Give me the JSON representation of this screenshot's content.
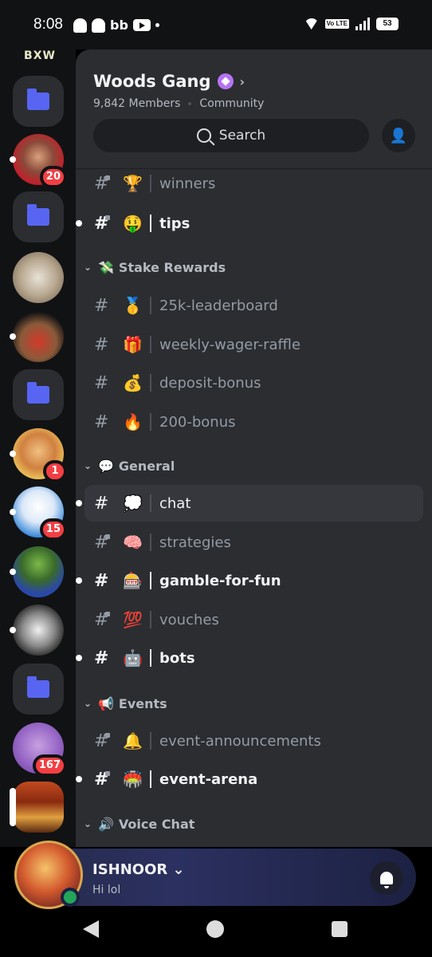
{
  "status_bar": {
    "time": "8:08",
    "left_icons": [
      "snapchat-icon",
      "snapchat-icon",
      "bb-icon",
      "youtube-icon",
      "dot-icon"
    ],
    "bb_label": "bb",
    "volte_label": "Vo LTE",
    "battery": "53"
  },
  "rail": {
    "logo_text": "BXW",
    "items": [
      {
        "type": "folder"
      },
      {
        "type": "avatar",
        "badge": "20"
      },
      {
        "type": "folder"
      },
      {
        "type": "avatar",
        "badge": ""
      },
      {
        "type": "avatar",
        "badge": ""
      },
      {
        "type": "folder"
      },
      {
        "type": "avatar",
        "badge": "1"
      },
      {
        "type": "avatar",
        "badge": "15"
      },
      {
        "type": "avatar",
        "badge": ""
      },
      {
        "type": "avatar",
        "badge": ""
      },
      {
        "type": "folder"
      },
      {
        "type": "avatar",
        "badge": "167"
      },
      {
        "type": "avatar",
        "badge": ""
      }
    ]
  },
  "server": {
    "name": "Woods Gang",
    "members": "9,842 Members",
    "type": "Community",
    "search_label": "Search"
  },
  "channels": {
    "winners": {
      "emoji": "🏆",
      "name": "winners"
    },
    "tips": {
      "emoji": "🤑",
      "name": "tips"
    },
    "cat_stake": {
      "emoji": "💸",
      "name": "Stake Rewards"
    },
    "leaderboard": {
      "emoji": "🥇",
      "name": "25k-leaderboard"
    },
    "raffle": {
      "emoji": "🎁",
      "name": "weekly-wager-raffle"
    },
    "deposit": {
      "emoji": "💰",
      "name": "deposit-bonus"
    },
    "bonus200": {
      "emoji": "🔥",
      "name": "200-bonus"
    },
    "cat_general": {
      "emoji": "💬",
      "name": "General"
    },
    "chat": {
      "emoji": "💭",
      "name": "chat"
    },
    "strategies": {
      "emoji": "🧠",
      "name": "strategies"
    },
    "gamble": {
      "emoji": "🎰",
      "name": "gamble-for-fun"
    },
    "vouches": {
      "emoji": "💯",
      "name": "vouches"
    },
    "bots": {
      "emoji": "🤖",
      "name": "bots"
    },
    "cat_events": {
      "emoji": "📢",
      "name": "Events"
    },
    "event_ann": {
      "emoji": "🔔",
      "name": "event-announcements"
    },
    "event_arena": {
      "emoji": "🏟️",
      "name": "event-arena"
    },
    "cat_voice": {
      "emoji": "🔊",
      "name": "Voice Chat"
    }
  },
  "user": {
    "name": "ISHNOOR",
    "status": "Hi lol"
  }
}
